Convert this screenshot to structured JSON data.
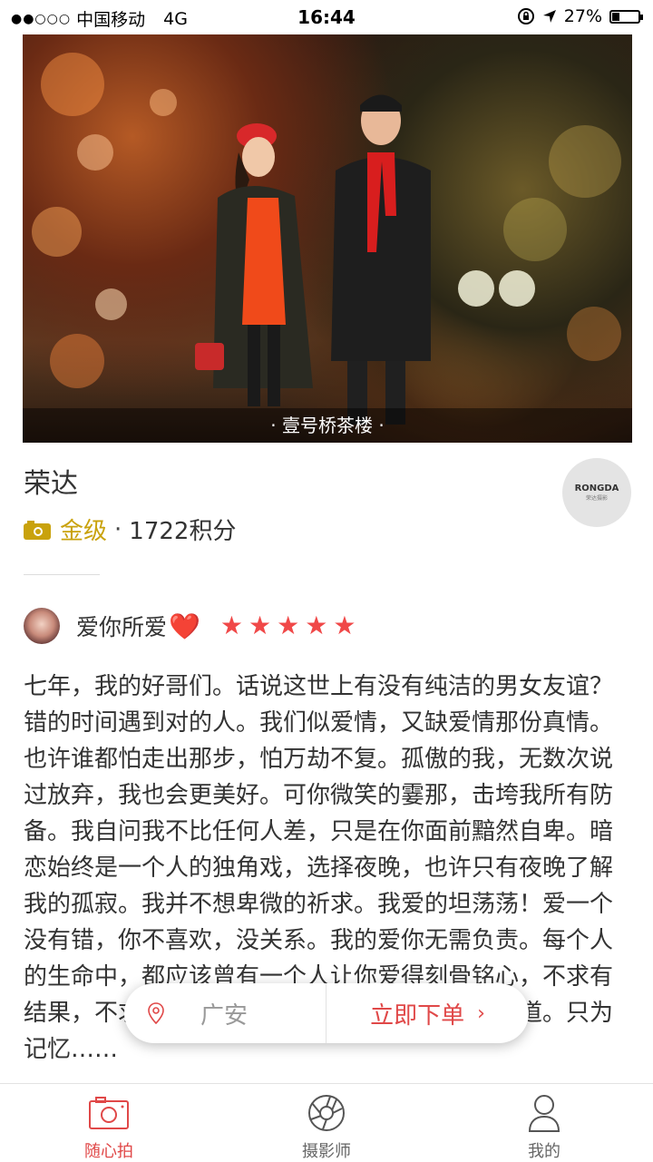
{
  "status": {
    "carrier": "中国移动",
    "network": "4G",
    "time": "16:44",
    "battery": "27%",
    "battery_level": 0.27
  },
  "hero": {
    "caption": "· 壹号桥茶楼 ·"
  },
  "photographer": {
    "name": "荣达",
    "level": "金级",
    "points": "1722积分",
    "separator": "·",
    "logo_brand": "RONGDA",
    "logo_sub": "荣达摄影"
  },
  "review": {
    "reviewer": "爱你所爱",
    "heart": "❤️",
    "rating": 5,
    "text": "七年，我的好哥们。话说这世上有没有纯洁的男女友谊？错的时间遇到对的人。我们似爱情，又缺爱情那份真情。也许谁都怕走出那步，怕万劫不复。孤傲的我，无数次说过放弃，我也会更美好。可你微笑的霎那，击垮我所有防备。我自问我不比任何人差，只是在你面前黯然自卑。暗恋始终是一个人的独角戏，选择夜晚，也许只有夜晚了解我的孤寂。我并不想卑微的祈求。我爱的坦荡荡！爱一个没有错，你不喜欢，没关系。我的爱你无需负责。每个人的生命中，都应该曾有一个人让你爱得刻骨铭心，不求有结果，不求同行，不求曾经拥有。甚至不求他知道。只为记忆……"
  },
  "float_bar": {
    "location": "广安",
    "order": "立即下单",
    "chevron": "›"
  },
  "tabs": [
    {
      "label": "随心拍"
    },
    {
      "label": "摄影师"
    },
    {
      "label": "我的"
    }
  ],
  "colors": {
    "accent": "#e04848",
    "gold": "#c9a20c"
  }
}
